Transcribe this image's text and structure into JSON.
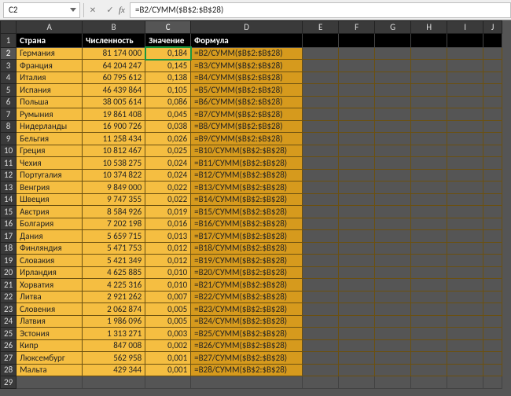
{
  "formula_bar": {
    "cell_ref": "C2",
    "fx_label": "fx",
    "formula": "=B2/СУММ($B$2:$B$28)"
  },
  "columns": [
    "A",
    "B",
    "C",
    "D",
    "E",
    "F",
    "G",
    "H",
    "I",
    "J"
  ],
  "header": {
    "A": "Страна",
    "B": "Численность",
    "C": "Значение",
    "D": "Формула"
  },
  "active_cell": {
    "row": 2,
    "col": "C"
  },
  "first_row": 2,
  "rows": [
    {
      "n": 2,
      "A": "Германия",
      "B": "81 174 000",
      "C": "0,184",
      "D": "=B2/СУММ($B$2:$B$28)"
    },
    {
      "n": 3,
      "A": "Франция",
      "B": "64 204 247",
      "C": "0,145",
      "D": "=B3/СУММ($B$2:$B$28)"
    },
    {
      "n": 4,
      "A": "Италия",
      "B": "60 795 612",
      "C": "0,138",
      "D": "=B4/СУММ($B$2:$B$28)"
    },
    {
      "n": 5,
      "A": "Испания",
      "B": "46 439 864",
      "C": "0,105",
      "D": "=B5/СУММ($B$2:$B$28)"
    },
    {
      "n": 6,
      "A": "Польша",
      "B": "38 005 614",
      "C": "0,086",
      "D": "=B6/СУММ($B$2:$B$28)"
    },
    {
      "n": 7,
      "A": "Румыния",
      "B": "19 861 408",
      "C": "0,045",
      "D": "=B7/СУММ($B$2:$B$28)"
    },
    {
      "n": 8,
      "A": "Нидерланды",
      "B": "16 900 726",
      "C": "0,038",
      "D": "=B8/СУММ($B$2:$B$28)"
    },
    {
      "n": 9,
      "A": "Бельгия",
      "B": "11 258 434",
      "C": "0,026",
      "D": "=B9/СУММ($B$2:$B$28)"
    },
    {
      "n": 10,
      "A": "Греция",
      "B": "10 812 467",
      "C": "0,025",
      "D": "=B10/СУММ($B$2:$B$28)"
    },
    {
      "n": 11,
      "A": "Чехия",
      "B": "10 538 275",
      "C": "0,024",
      "D": "=B11/СУММ($B$2:$B$28)"
    },
    {
      "n": 12,
      "A": "Португалия",
      "B": "10 374 822",
      "C": "0,024",
      "D": "=B12/СУММ($B$2:$B$28)"
    },
    {
      "n": 13,
      "A": "Венгрия",
      "B": "9 849 000",
      "C": "0,022",
      "D": "=B13/СУММ($B$2:$B$28)"
    },
    {
      "n": 14,
      "A": "Швеция",
      "B": "9 747 355",
      "C": "0,022",
      "D": "=B14/СУММ($B$2:$B$28)"
    },
    {
      "n": 15,
      "A": "Австрия",
      "B": "8 584 926",
      "C": "0,019",
      "D": "=B15/СУММ($B$2:$B$28)"
    },
    {
      "n": 16,
      "A": "Болгария",
      "B": "7 202 198",
      "C": "0,016",
      "D": "=B16/СУММ($B$2:$B$28)"
    },
    {
      "n": 17,
      "A": "Дания",
      "B": "5 659 715",
      "C": "0,013",
      "D": "=B17/СУММ($B$2:$B$28)"
    },
    {
      "n": 18,
      "A": "Финляндия",
      "B": "5 471 753",
      "C": "0,012",
      "D": "=B18/СУММ($B$2:$B$28)"
    },
    {
      "n": 19,
      "A": "Словакия",
      "B": "5 421 349",
      "C": "0,012",
      "D": "=B19/СУММ($B$2:$B$28)"
    },
    {
      "n": 20,
      "A": "Ирландия",
      "B": "4 625 885",
      "C": "0,010",
      "D": "=B20/СУММ($B$2:$B$28)"
    },
    {
      "n": 21,
      "A": "Хорватия",
      "B": "4 225 316",
      "C": "0,010",
      "D": "=B21/СУММ($B$2:$B$28)"
    },
    {
      "n": 22,
      "A": "Литва",
      "B": "2 921 262",
      "C": "0,007",
      "D": "=B22/СУММ($B$2:$B$28)"
    },
    {
      "n": 23,
      "A": "Словения",
      "B": "2 062 874",
      "C": "0,005",
      "D": "=B23/СУММ($B$2:$B$28)"
    },
    {
      "n": 24,
      "A": "Латвия",
      "B": "1 986 096",
      "C": "0,005",
      "D": "=B24/СУММ($B$2:$B$28)"
    },
    {
      "n": 25,
      "A": "Эстония",
      "B": "1 313 271",
      "C": "0,003",
      "D": "=B25/СУММ($B$2:$B$28)"
    },
    {
      "n": 26,
      "A": "Кипр",
      "B": "847 008",
      "C": "0,002",
      "D": "=B26/СУММ($B$2:$B$28)"
    },
    {
      "n": 27,
      "A": "Люксембург",
      "B": "562 958",
      "C": "0,001",
      "D": "=B27/СУММ($B$2:$B$28)"
    },
    {
      "n": 28,
      "A": "Мальта",
      "B": "429 344",
      "C": "0,001",
      "D": "=B28/СУММ($B$2:$B$28)"
    }
  ],
  "trailing_empty_row": 29
}
